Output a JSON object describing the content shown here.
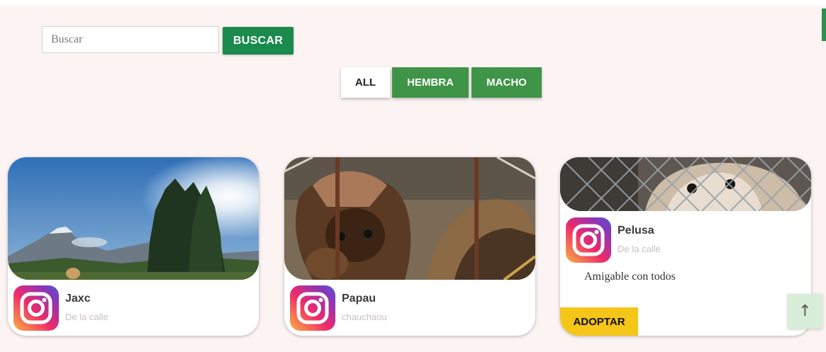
{
  "search": {
    "placeholder": "Buscar",
    "value": "",
    "button_label": "BUSCAR"
  },
  "filters": [
    {
      "label": "ALL",
      "active": true
    },
    {
      "label": "HEMBRA",
      "active": false
    },
    {
      "label": "MACHO",
      "active": false
    }
  ],
  "pets": [
    {
      "name": "Jaxc",
      "origin": "De la calle",
      "description": "",
      "show_adopt": false,
      "icon": "instagram-icon"
    },
    {
      "name": "Papau",
      "origin": "chauchaou",
      "description": "",
      "show_adopt": false,
      "icon": "instagram-icon"
    },
    {
      "name": "Pelusa",
      "origin": "De la calle",
      "description": "Amigable con todos",
      "show_adopt": true,
      "adopt_label": "ADOPTAR",
      "icon": "instagram-icon"
    }
  ],
  "scroll_top": {
    "icon": "arrow-up-icon",
    "glyph": "↑"
  },
  "colors": {
    "page_background": "#fcf4f3",
    "primary_green": "#1b8a4e",
    "filter_green": "#3f9448",
    "adopt_yellow": "#f5c518"
  }
}
